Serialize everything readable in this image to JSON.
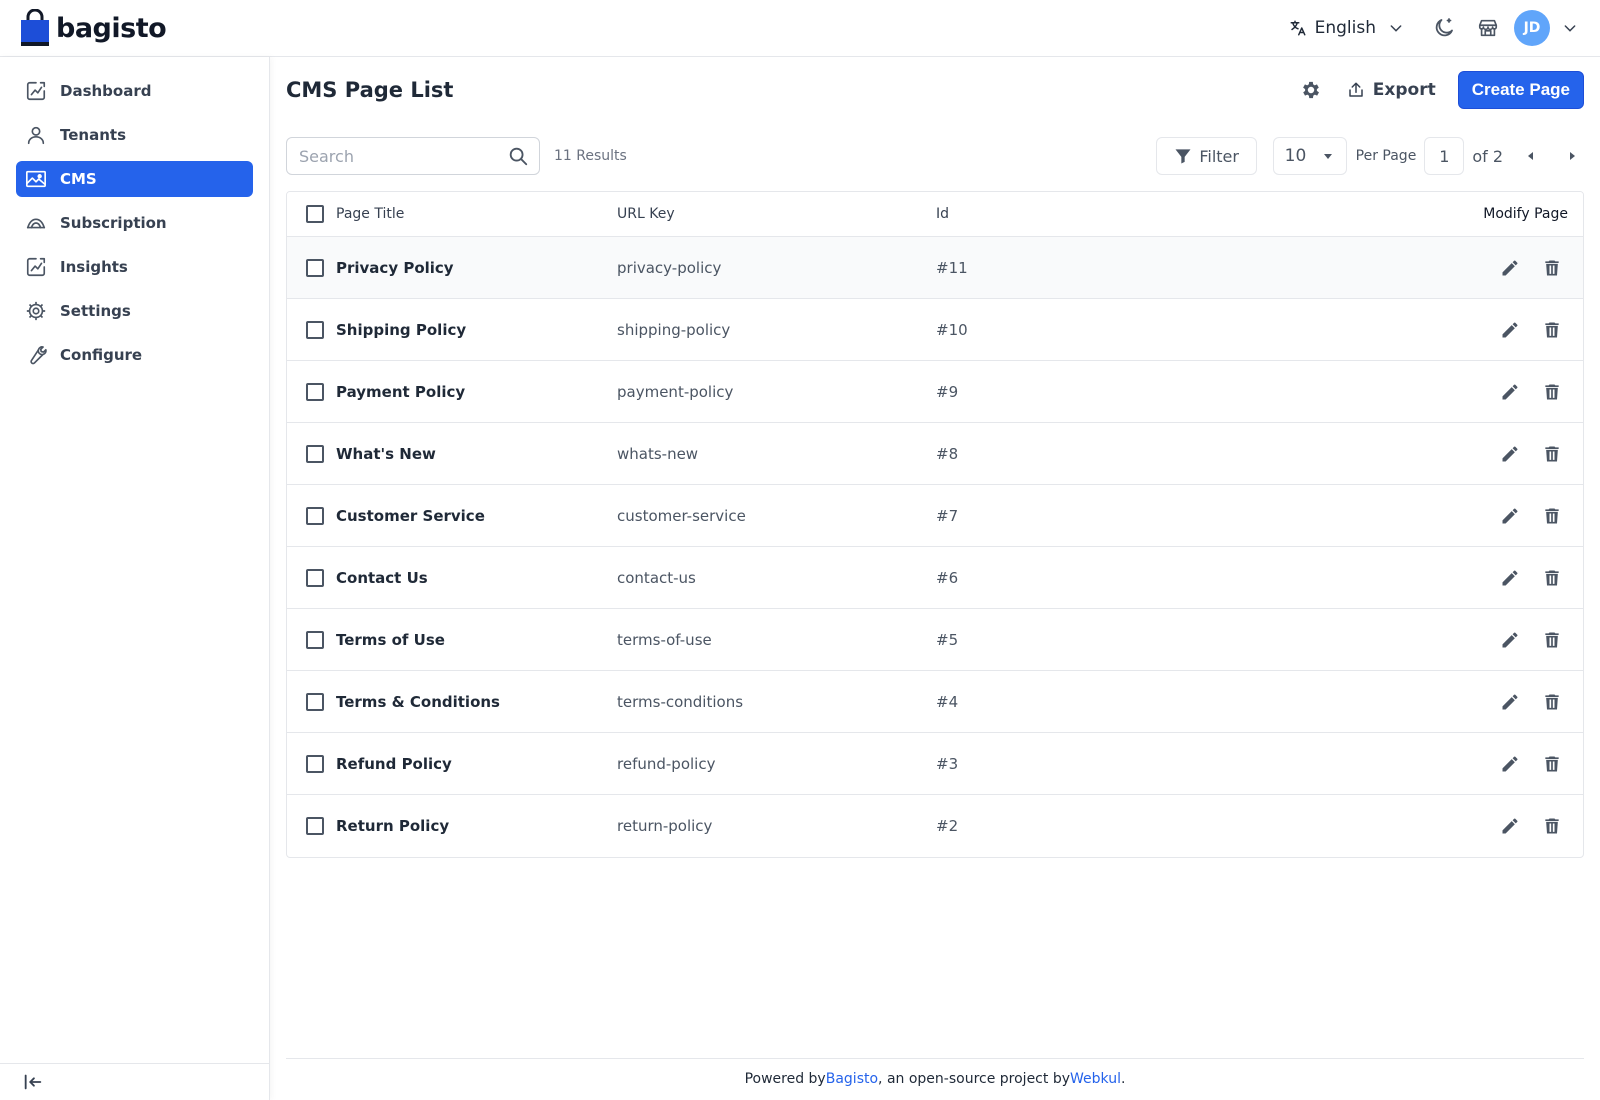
{
  "brand": {
    "name": "bagisto"
  },
  "header": {
    "language": "English",
    "user_initials": "JD"
  },
  "sidebar": {
    "items": [
      {
        "label": "Dashboard",
        "icon": "dashboard-icon"
      },
      {
        "label": "Tenants",
        "icon": "user-icon"
      },
      {
        "label": "CMS",
        "icon": "image-icon",
        "active": true
      },
      {
        "label": "Subscription",
        "icon": "subscription-icon"
      },
      {
        "label": "Insights",
        "icon": "chart-icon"
      },
      {
        "label": "Settings",
        "icon": "gear-icon"
      },
      {
        "label": "Configure",
        "icon": "wrench-icon"
      }
    ]
  },
  "page": {
    "title": "CMS Page List",
    "export_label": "Export",
    "create_label": "Create Page"
  },
  "toolbar": {
    "search_placeholder": "Search",
    "results": "11 Results",
    "filter_label": "Filter",
    "per_page_value": "10",
    "per_page_label": "Per Page",
    "current_page": "1",
    "of_label": "of 2"
  },
  "table": {
    "headers": {
      "title": "Page Title",
      "url": "URL Key",
      "id": "Id",
      "modify": "Modify Page"
    },
    "rows": [
      {
        "title": "Privacy Policy",
        "url": "privacy-policy",
        "id": "#11"
      },
      {
        "title": "Shipping Policy",
        "url": "shipping-policy",
        "id": "#10"
      },
      {
        "title": "Payment Policy",
        "url": "payment-policy",
        "id": "#9"
      },
      {
        "title": "What's New",
        "url": "whats-new",
        "id": "#8"
      },
      {
        "title": "Customer Service",
        "url": "customer-service",
        "id": "#7"
      },
      {
        "title": "Contact Us",
        "url": "contact-us",
        "id": "#6"
      },
      {
        "title": "Terms of Use",
        "url": "terms-of-use",
        "id": "#5"
      },
      {
        "title": "Terms & Conditions",
        "url": "terms-conditions",
        "id": "#4"
      },
      {
        "title": "Refund Policy",
        "url": "refund-policy",
        "id": "#3"
      },
      {
        "title": "Return Policy",
        "url": "return-policy",
        "id": "#2"
      }
    ]
  },
  "footer": {
    "prefix": "Powered by ",
    "link1": "Bagisto",
    "middle": ", an open-source project by ",
    "link2": "Webkul",
    "suffix": "."
  },
  "colors": {
    "accent": "#2563eb",
    "avatar": "#60a5fa",
    "icon": "#4b5563"
  }
}
